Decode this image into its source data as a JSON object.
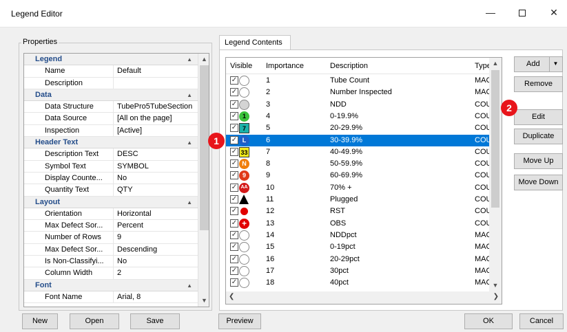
{
  "window": {
    "title": "Legend Editor",
    "minimize": "—",
    "close": "✕"
  },
  "properties": {
    "group_label": "Properties",
    "rows": [
      {
        "type": "cat",
        "label": "Legend"
      },
      {
        "type": "prop",
        "name": "Name",
        "value": "Default"
      },
      {
        "type": "prop",
        "name": "Description",
        "value": ""
      },
      {
        "type": "cat",
        "label": "Data"
      },
      {
        "type": "prop",
        "name": "Data Structure",
        "value": "TubePro5TubeSection"
      },
      {
        "type": "prop",
        "name": "Data Source",
        "value": "[All on the page]"
      },
      {
        "type": "prop",
        "name": "Inspection",
        "value": "[Active]"
      },
      {
        "type": "cat",
        "label": "Header Text"
      },
      {
        "type": "prop",
        "name": "Description Text",
        "value": "DESC"
      },
      {
        "type": "prop",
        "name": "Symbol Text",
        "value": "SYMBOL"
      },
      {
        "type": "prop",
        "name": "Display Counte...",
        "value": "No"
      },
      {
        "type": "prop",
        "name": "Quantity Text",
        "value": "QTY"
      },
      {
        "type": "cat",
        "label": "Layout"
      },
      {
        "type": "prop",
        "name": "Orientation",
        "value": "Horizontal"
      },
      {
        "type": "prop",
        "name": "Max Defect Sor...",
        "value": "Percent"
      },
      {
        "type": "prop",
        "name": "Number of Rows",
        "value": "9"
      },
      {
        "type": "prop",
        "name": "Max Defect Sor...",
        "value": "Descending"
      },
      {
        "type": "prop",
        "name": "Is Non-Classifyi...",
        "value": "No"
      },
      {
        "type": "prop",
        "name": "Column Width",
        "value": "2"
      },
      {
        "type": "cat",
        "label": "Font"
      },
      {
        "type": "prop",
        "name": "Font Name",
        "value": "Arial, 8"
      }
    ]
  },
  "legend_contents": {
    "tab_label": "Legend Contents",
    "headers": {
      "visible": "Visible",
      "importance": "Importance",
      "description": "Description",
      "type": "Type"
    },
    "rows": [
      {
        "importance": "1",
        "description": "Tube Count",
        "type": "MACF",
        "symbol": "white-circle",
        "color": "#ffffff",
        "text": ""
      },
      {
        "importance": "2",
        "description": "Number Inspected",
        "type": "MACF",
        "symbol": "white-circle",
        "color": "#ffffff",
        "text": ""
      },
      {
        "importance": "3",
        "description": "NDD",
        "type": "COUN",
        "symbol": "gray-circle",
        "color": "#d4d4d4",
        "text": ""
      },
      {
        "importance": "4",
        "description": "0-19.9%",
        "type": "COUN",
        "symbol": "green-circle",
        "color": "#3cc23c",
        "text": "1"
      },
      {
        "importance": "5",
        "description": "20-29.9%",
        "type": "COUN",
        "symbol": "teal-square",
        "color": "#1ab2a9",
        "text": "7"
      },
      {
        "importance": "6",
        "description": "30-39.9%",
        "type": "COUN",
        "symbol": "blue-circle",
        "color": "#1f5fc8",
        "text": "L"
      },
      {
        "importance": "7",
        "description": "40-49.9%",
        "type": "COUN",
        "symbol": "yellow-square",
        "color": "#f2ea1d",
        "text": "33"
      },
      {
        "importance": "8",
        "description": "50-59.9%",
        "type": "COUN",
        "symbol": "orange-circle",
        "color": "#f07f0d",
        "text": "N"
      },
      {
        "importance": "9",
        "description": "60-69.9%",
        "type": "COUN",
        "symbol": "red-circle",
        "color": "#e03a1a",
        "text": "9"
      },
      {
        "importance": "10",
        "description": "70% +",
        "type": "COUN",
        "symbol": "red-aa-circle",
        "color": "#d41a1a",
        "text": "AA"
      },
      {
        "importance": "11",
        "description": "Plugged",
        "type": "COUN",
        "symbol": "black-triangle",
        "color": "#000000",
        "text": ""
      },
      {
        "importance": "12",
        "description": "RST",
        "type": "COUN",
        "symbol": "red-dot",
        "color": "#e10000",
        "text": ""
      },
      {
        "importance": "13",
        "description": "OBS",
        "type": "COUN",
        "symbol": "red-cross-circle",
        "color": "#e10000",
        "text": ""
      },
      {
        "importance": "14",
        "description": "NDDpct",
        "type": "MACF",
        "symbol": "white-circle",
        "color": "#ffffff",
        "text": ""
      },
      {
        "importance": "15",
        "description": "0-19pct",
        "type": "MACF",
        "symbol": "white-circle",
        "color": "#ffffff",
        "text": ""
      },
      {
        "importance": "16",
        "description": "20-29pct",
        "type": "MACF",
        "symbol": "white-circle",
        "color": "#ffffff",
        "text": ""
      },
      {
        "importance": "17",
        "description": "30pct",
        "type": "MACF",
        "symbol": "white-circle",
        "color": "#ffffff",
        "text": ""
      },
      {
        "importance": "18",
        "description": "40pct",
        "type": "MACF",
        "symbol": "white-circle",
        "color": "#ffffff",
        "text": ""
      }
    ]
  },
  "side_buttons": {
    "add": "Add",
    "remove": "Remove",
    "edit": "Edit",
    "duplicate": "Duplicate",
    "move_up": "Move Up",
    "move_down": "Move Down"
  },
  "bottom_buttons": {
    "new": "New",
    "open": "Open",
    "save": "Save",
    "preview": "Preview",
    "ok": "OK",
    "cancel": "Cancel"
  },
  "callouts": {
    "first": "1",
    "second": "2"
  },
  "colors": {
    "selection": "#0078d7",
    "callout": "#e8151b",
    "category_text": "#244d8a"
  }
}
